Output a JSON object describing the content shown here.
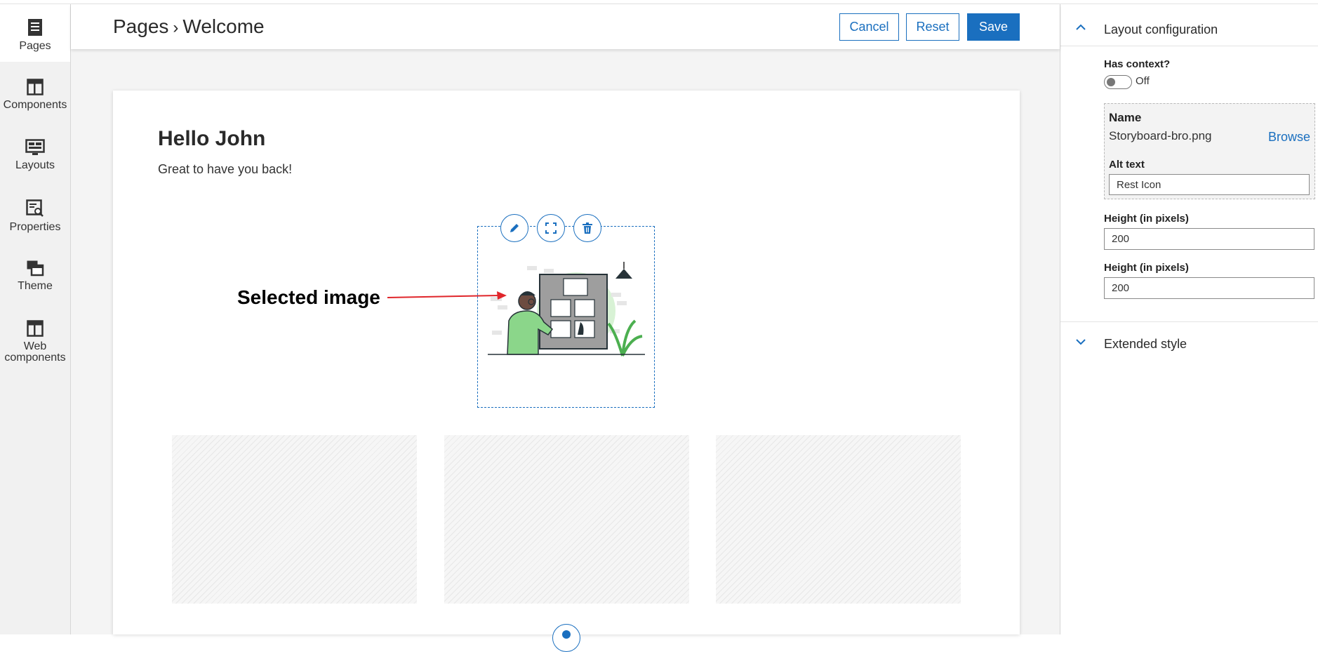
{
  "rail": {
    "items": [
      {
        "label": "Pages",
        "icon": "pages-icon"
      },
      {
        "label": "Components",
        "icon": "components-icon"
      },
      {
        "label": "Layouts",
        "icon": "layouts-icon"
      },
      {
        "label": "Properties",
        "icon": "properties-icon"
      },
      {
        "label": "Theme",
        "icon": "theme-icon"
      },
      {
        "label": "Web\ncomponents",
        "icon": "web-components-icon"
      }
    ]
  },
  "header": {
    "breadcrumb_root": "Pages",
    "breadcrumb_separator": "›",
    "breadcrumb_current": "Welcome",
    "cancel_label": "Cancel",
    "reset_label": "Reset",
    "save_label": "Save"
  },
  "canvas": {
    "greeting": "Hello John",
    "subtext": "Great to have you back!",
    "annotation": "Selected image"
  },
  "panel": {
    "layout_title": "Layout configuration",
    "has_context_label": "Has context?",
    "has_context_value": "Off",
    "name_label": "Name",
    "name_value": "Storyboard-bro.png",
    "browse_label": "Browse",
    "alt_label": "Alt text",
    "alt_value": "Rest Icon",
    "height1_label": "Height (in pixels)",
    "height1_value": "200",
    "height2_label": "Height (in pixels)",
    "height2_value": "200",
    "extended_title": "Extended style"
  },
  "colors": {
    "accent": "#1a6fbf",
    "annotation_arrow": "#e0262b"
  }
}
